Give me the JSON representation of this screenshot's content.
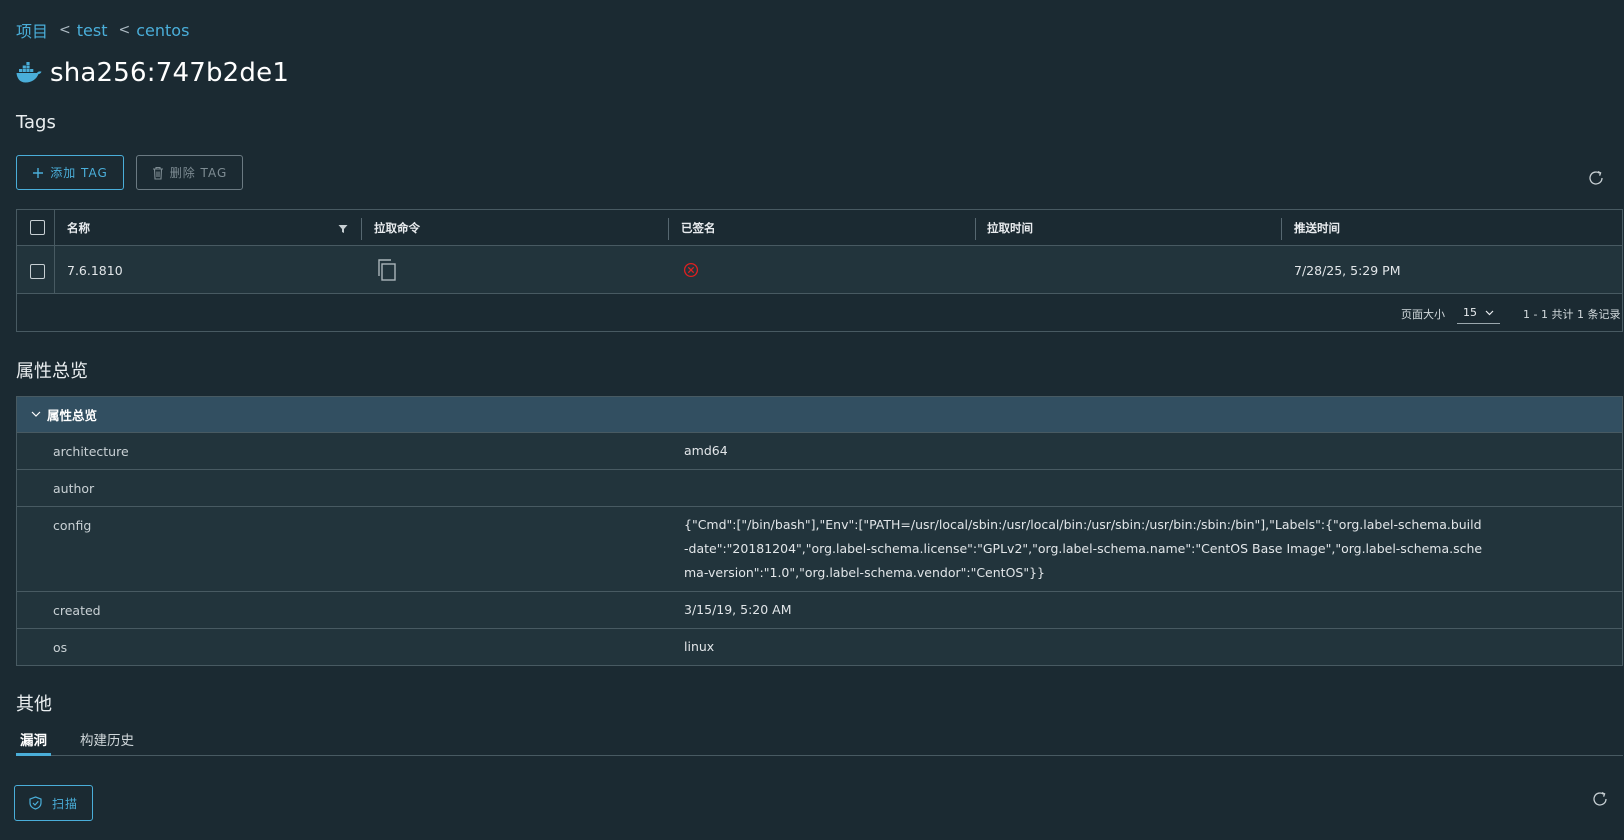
{
  "breadcrumb": {
    "items": [
      "项目",
      "test",
      "centos"
    ],
    "separator": "<"
  },
  "artifact": {
    "icon": "docker-whale-icon",
    "title": "sha256:747b2de1"
  },
  "tags_section": {
    "heading": "Tags",
    "add_button": "添加 TAG",
    "delete_button": "删除 TAG",
    "columns": [
      "名称",
      "拉取命令",
      "已签名",
      "拉取时间",
      "推送时间"
    ],
    "rows": [
      {
        "name": "7.6.1810",
        "pull_command_icon": "copy-icon",
        "signed_icon": "error-circle-icon",
        "pull_time": "",
        "push_time": "7/28/25, 5:29 PM"
      }
    ],
    "footer": {
      "page_size_label": "页面大小",
      "page_size_value": "15",
      "pagination_info": "1 - 1 共计 1 条记录"
    }
  },
  "properties_section": {
    "heading": "属性总览",
    "panel_title": "属性总览",
    "rows": [
      {
        "key": "architecture",
        "value": "amd64"
      },
      {
        "key": "author",
        "value": ""
      },
      {
        "key": "config",
        "value": "{\"Cmd\":[\"/bin/bash\"],\"Env\":[\"PATH=/usr/local/sbin:/usr/local/bin:/usr/sbin:/usr/bin:/sbin:/bin\"],\"Labels\":{\"org.label-schema.build-date\":\"20181204\",\"org.label-schema.license\":\"GPLv2\",\"org.label-schema.name\":\"CentOS Base Image\",\"org.label-schema.schema-version\":\"1.0\",\"org.label-schema.vendor\":\"CentOS\"}}"
      },
      {
        "key": "created",
        "value": "3/15/19, 5:20 AM"
      },
      {
        "key": "os",
        "value": "linux"
      }
    ]
  },
  "other_section": {
    "heading": "其他",
    "tabs": [
      {
        "label": "漏洞",
        "active": true
      },
      {
        "label": "构建历史",
        "active": false
      }
    ],
    "scan_button": "扫描"
  },
  "colors": {
    "background": "#1b2a32",
    "accent": "#4aaed9",
    "panel_header": "#324f61",
    "row_bg": "#22343c",
    "error": "#e02020"
  }
}
